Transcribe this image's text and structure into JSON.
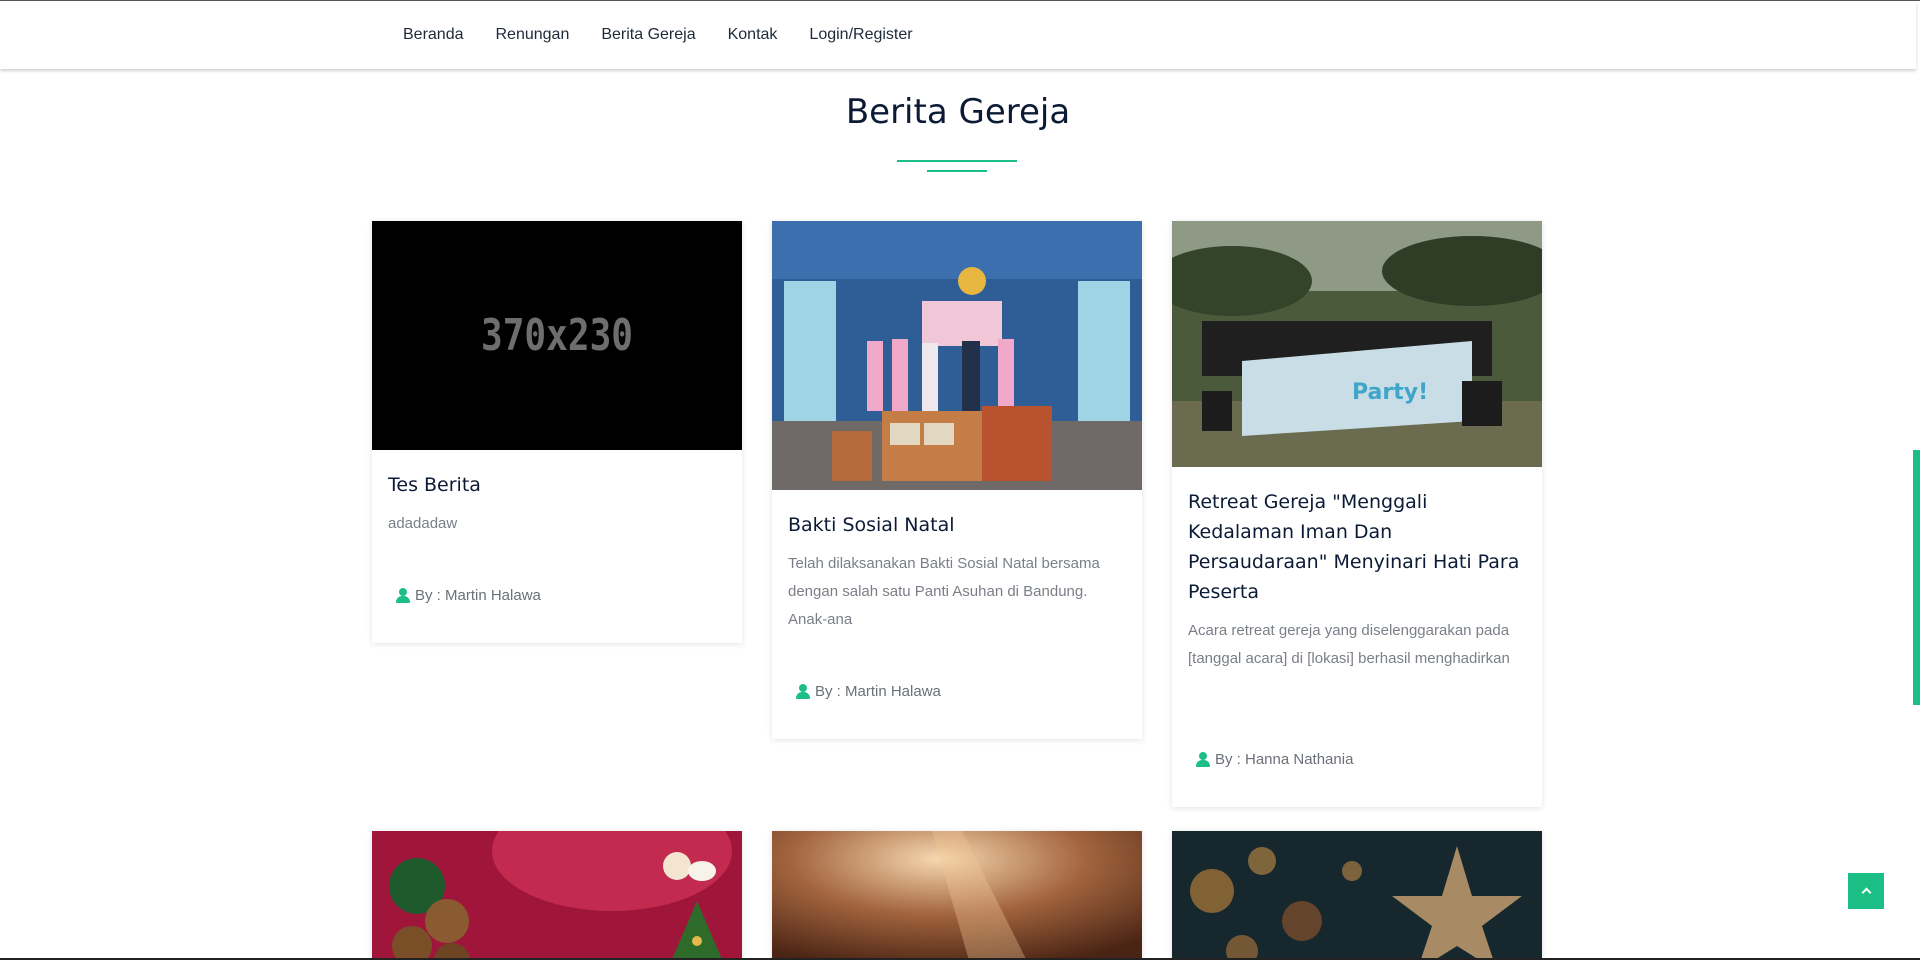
{
  "nav": {
    "items": [
      {
        "label": "Beranda"
      },
      {
        "label": "Renungan"
      },
      {
        "label": "Berita Gereja"
      },
      {
        "label": "Kontak"
      },
      {
        "label": "Login/Register"
      }
    ]
  },
  "section": {
    "title": "Berita Gereja"
  },
  "cards": [
    {
      "title": "Tes Berita",
      "excerpt": "adadadaw",
      "author": "By : Martin Halawa",
      "image_text": "370x230"
    },
    {
      "title": "Bakti Sosial Natal",
      "excerpt": "Telah dilaksanakan Bakti Sosial Natal bersama dengan salah satu Panti Asuhan di Bandung. Anak-ana",
      "author": "By : Martin Halawa"
    },
    {
      "title": "Retreat Gereja \"Menggali Kedalaman Iman Dan Persaudaraan\" Menyinari Hati Para Peserta",
      "excerpt": "Acara retreat gereja yang diselenggarakan pada [tanggal acara] di [lokasi] berhasil menghadirkan",
      "author": "By : Hanna Nathania"
    }
  ],
  "colors": {
    "accent": "#1bbf85",
    "title": "#0c1b35"
  },
  "icons": {
    "author": "user-icon",
    "back_to_top": "chevron-up-icon"
  }
}
